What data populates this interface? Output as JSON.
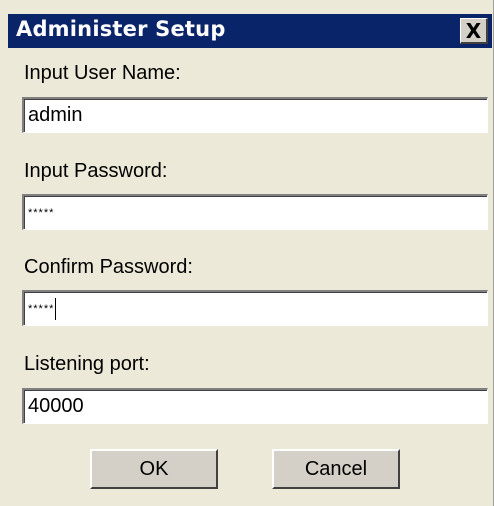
{
  "window": {
    "title": "Administer Setup",
    "close_glyph": "X"
  },
  "fields": {
    "username": {
      "label": "Input User Name:",
      "value": "admin"
    },
    "password": {
      "label": "Input Password:",
      "value": "*****"
    },
    "confirm": {
      "label": "Confirm Password:",
      "value": "*****"
    },
    "port": {
      "label": "Listening port:",
      "value": "40000"
    }
  },
  "buttons": {
    "ok": "OK",
    "cancel": "Cancel"
  },
  "colors": {
    "titlebar": "#0a246a",
    "face": "#ece9d8",
    "button": "#d4d0c8"
  }
}
